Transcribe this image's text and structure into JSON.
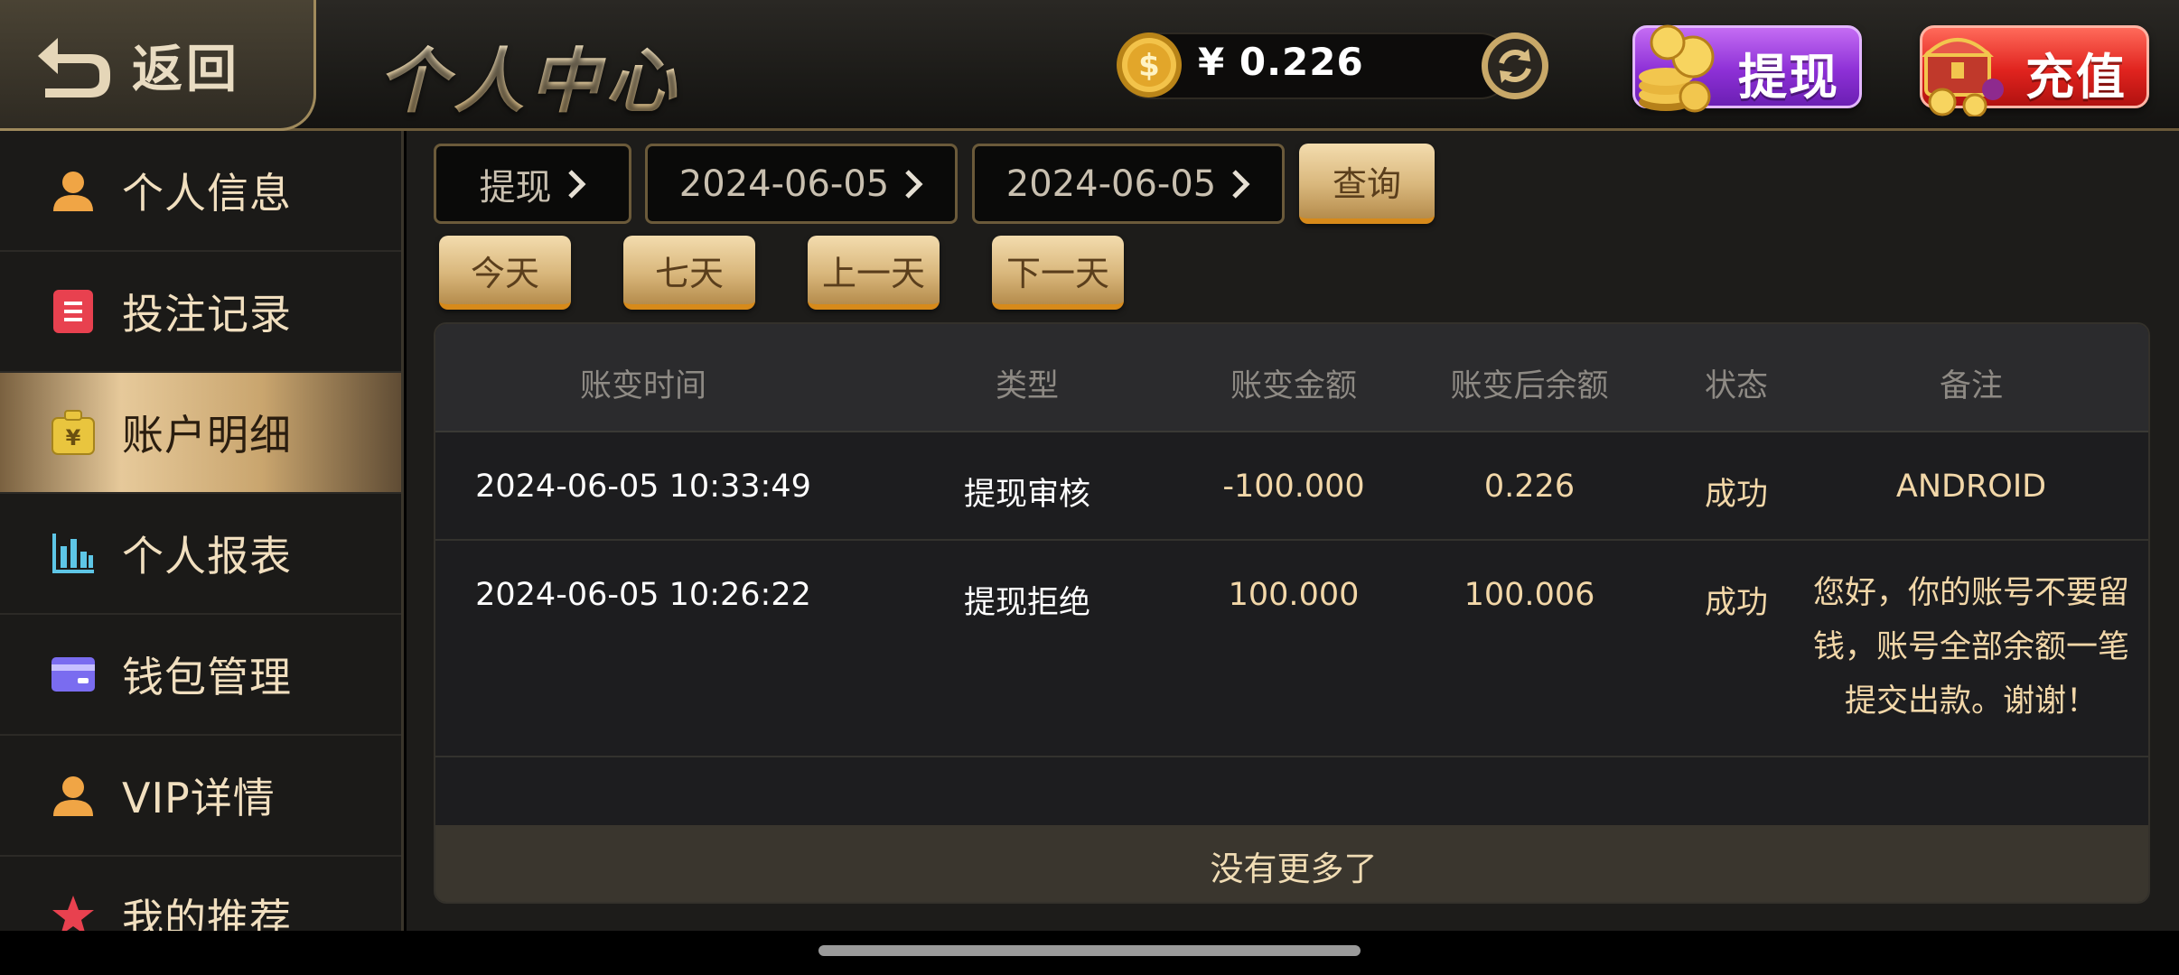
{
  "header": {
    "back_label": "返回",
    "title": "个人中心",
    "balance": "¥ 0.226",
    "withdraw_label": "提现",
    "recharge_label": "充值"
  },
  "sidebar": {
    "items": [
      {
        "label": "个人信息",
        "icon": "user-icon",
        "active": false
      },
      {
        "label": "投注记录",
        "icon": "document-icon",
        "active": false
      },
      {
        "label": "账户明细",
        "icon": "yuan-bag-icon",
        "active": true
      },
      {
        "label": "个人报表",
        "icon": "bar-chart-icon",
        "active": false
      },
      {
        "label": "钱包管理",
        "icon": "card-icon",
        "active": false
      },
      {
        "label": "VIP详情",
        "icon": "user-icon",
        "active": false
      },
      {
        "label": "我的推荐",
        "icon": "star-icon",
        "active": false
      }
    ]
  },
  "filters": {
    "type": "提现",
    "start_date": "2024-06-05",
    "end_date": "2024-06-05",
    "query_label": "查询",
    "quick": [
      "今天",
      "七天",
      "上一天",
      "下一天"
    ]
  },
  "table": {
    "columns": [
      "账变时间",
      "类型",
      "账变金额",
      "账变后余额",
      "状态",
      "备注"
    ],
    "rows": [
      {
        "time": "2024-06-05 10:33:49",
        "type": "提现审核",
        "amount": "-100.000",
        "balance": "0.226",
        "status": "成功",
        "note": "ANDROID"
      },
      {
        "time": "2024-06-05 10:26:22",
        "type": "提现拒绝",
        "amount": "100.000",
        "balance": "100.006",
        "status": "成功",
        "note": "您好，你的账号不要留钱，账号全部余额一笔提交出款。谢谢！"
      }
    ],
    "footer": "没有更多了"
  },
  "colors": {
    "accent_gold": "#d9b77c",
    "withdraw_purple": "#8d30d6",
    "recharge_red": "#e0231e"
  }
}
